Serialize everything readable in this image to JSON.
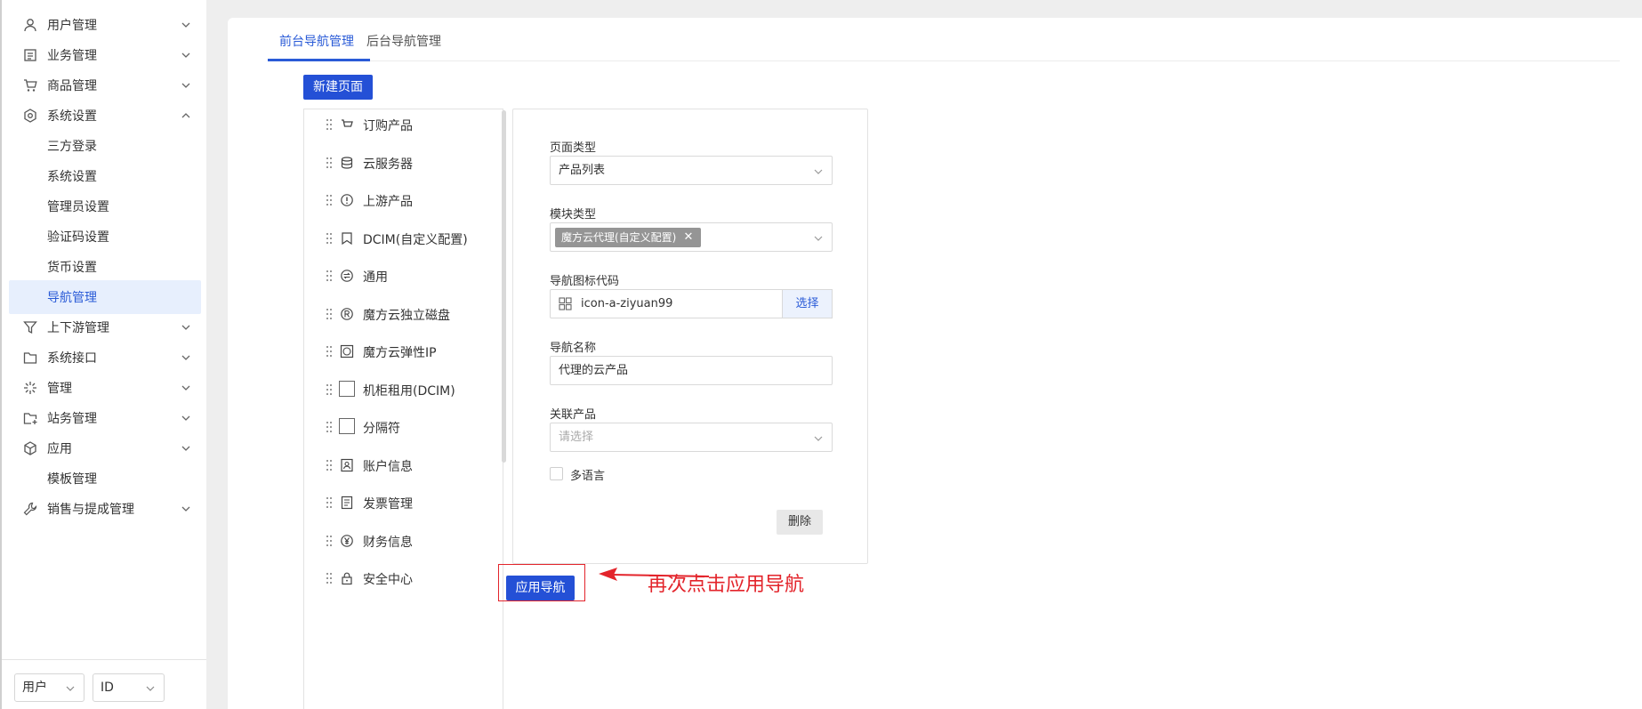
{
  "sidebar": {
    "items": [
      {
        "label": "用户管理",
        "icon": "user-icon",
        "arrow": "down"
      },
      {
        "label": "业务管理",
        "icon": "document-icon",
        "arrow": "down"
      },
      {
        "label": "商品管理",
        "icon": "cart-icon",
        "arrow": "down"
      },
      {
        "label": "系统设置",
        "icon": "settings-hexagon-icon",
        "arrow": "up"
      },
      {
        "label": "三方登录"
      },
      {
        "label": "系统设置"
      },
      {
        "label": "管理员设置"
      },
      {
        "label": "验证码设置"
      },
      {
        "label": "货币设置"
      },
      {
        "label": "导航管理",
        "active": true
      },
      {
        "label": "上下游管理",
        "icon": "filter-icon",
        "arrow": "down"
      },
      {
        "label": "系统接口",
        "icon": "folder-icon",
        "arrow": "down"
      },
      {
        "label": "管理",
        "icon": "sparkle-icon",
        "arrow": "down"
      },
      {
        "label": "站务管理",
        "icon": "folder-add-icon",
        "arrow": "down"
      },
      {
        "label": "应用",
        "icon": "cube-icon",
        "arrow": "down"
      },
      {
        "label": "模板管理"
      },
      {
        "label": "销售与提成管理",
        "icon": "wrench-icon",
        "arrow": "down"
      }
    ],
    "bottom_select_user": "用户",
    "bottom_select_id": "ID"
  },
  "tabs": [
    {
      "label": "前台导航管理",
      "active": true
    },
    {
      "label": "后台导航管理",
      "active": false
    }
  ],
  "new_page_button": "新建页面",
  "nav_list": [
    {
      "label": "订购产品",
      "icon": "basket-icon"
    },
    {
      "label": "云服务器",
      "icon": "database-icon"
    },
    {
      "label": "上游产品",
      "icon": "alert-circle-icon"
    },
    {
      "label": "DCIM(自定义配置)",
      "icon": "bookmark-icon"
    },
    {
      "label": "通用",
      "icon": "swap-circle-icon"
    },
    {
      "label": "魔方云独立磁盘",
      "icon": "registered-icon"
    },
    {
      "label": "魔方云弹性IP",
      "icon": "square-circle-icon"
    },
    {
      "label": "机柜租用(DCIM)",
      "icon": "empty-box-icon"
    },
    {
      "label": "分隔符",
      "icon": "empty-box-icon"
    },
    {
      "label": "账户信息",
      "icon": "id-card-icon"
    },
    {
      "label": "发票管理",
      "icon": "invoice-icon"
    },
    {
      "label": "财务信息",
      "icon": "yen-circle-icon"
    },
    {
      "label": "安全中心",
      "icon": "lock-icon"
    }
  ],
  "form": {
    "page_type_label": "页面类型",
    "page_type_value": "产品列表",
    "module_type_label": "模块类型",
    "module_type_tag": "魔方云代理(自定义配置)",
    "icon_code_label": "导航图标代码",
    "icon_code_value": "icon-a-ziyuan99",
    "select_button": "选择",
    "nav_name_label": "导航名称",
    "nav_name_value": "代理的云产品",
    "related_product_label": "关联产品",
    "related_product_placeholder": "请选择",
    "multilang_label": "多语言",
    "delete_button": "删除"
  },
  "apply_button": "应用导航",
  "annotation_text": "再次点击应用导航",
  "colors": {
    "primary": "#2450d6",
    "active_bg": "#e7effd",
    "annotation": "#e3242b"
  }
}
